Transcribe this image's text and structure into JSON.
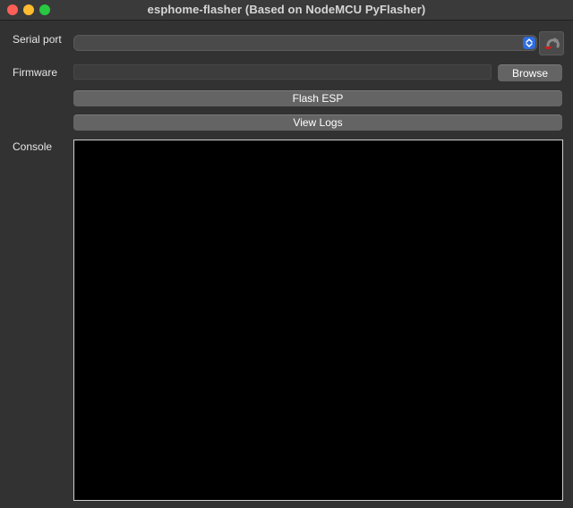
{
  "window": {
    "title": "esphome-flasher (Based on NodeMCU PyFlasher)"
  },
  "labels": {
    "serial_port": "Serial port",
    "firmware": "Firmware",
    "console": "Console"
  },
  "buttons": {
    "browse": "Browse",
    "flash": "Flash ESP",
    "view_logs": "View Logs"
  },
  "serial_port": {
    "selected": ""
  },
  "firmware": {
    "value": ""
  },
  "console": {
    "text": ""
  },
  "colors": {
    "window_bg": "#323232",
    "button_bg": "#646464",
    "accent_blue": "#2f6de1",
    "console_bg": "#000000"
  },
  "icons": {
    "reload": "reload-icon",
    "combo_arrow": "chevron-updown-icon"
  }
}
